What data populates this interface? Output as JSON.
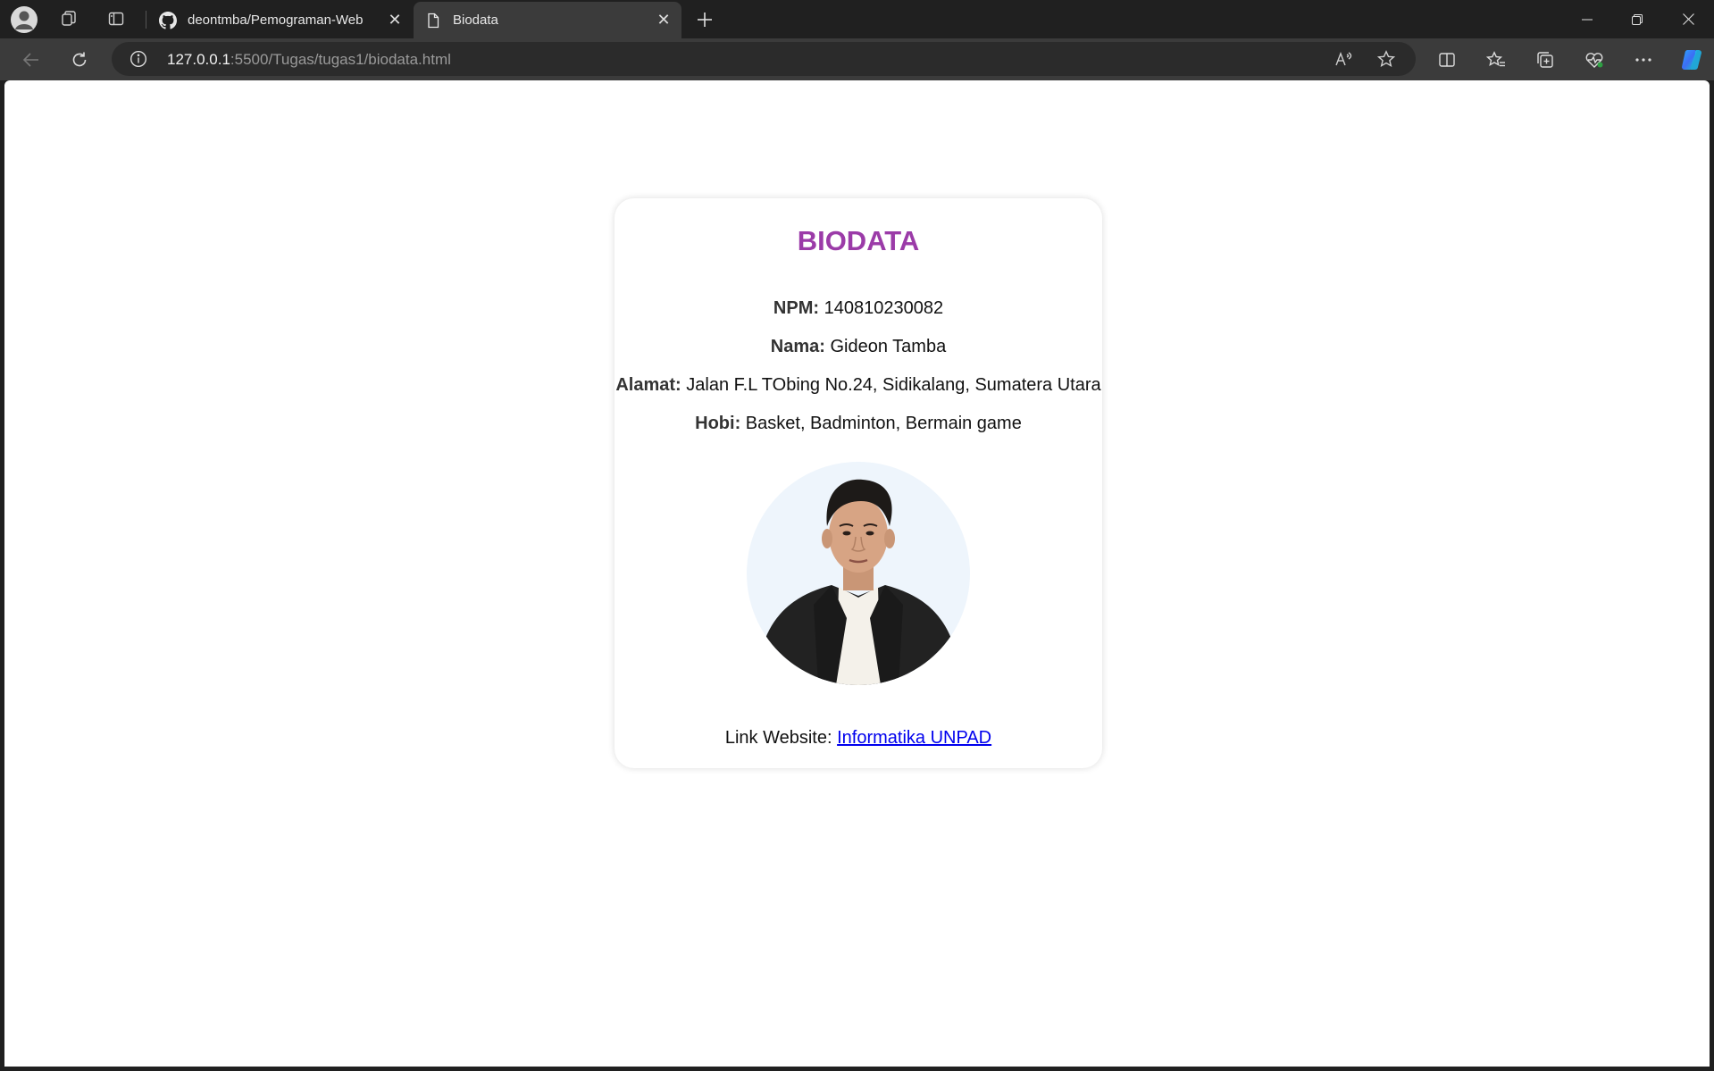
{
  "browser": {
    "tabs": [
      {
        "title": "deontmba/Pemograman-Web",
        "favicon": "github-icon",
        "active": false
      },
      {
        "title": "Biodata",
        "favicon": "page-icon",
        "active": true
      }
    ],
    "address": {
      "host": "127.0.0.1",
      "rest": ":5500/Tugas/tugas1/biodata.html"
    },
    "accent": "#9b3ba8"
  },
  "page": {
    "heading": "BIODATA",
    "fields": [
      {
        "label": "NPM:",
        "value": "140810230082"
      },
      {
        "label": "Nama:",
        "value": "Gideon Tamba"
      },
      {
        "label": "Alamat:",
        "value": "Jalan F.L TObing No.24, Sidikalang, Sumatera Utara"
      },
      {
        "label": "Hobi:",
        "value": "Basket, Badminton, Bermain game"
      }
    ],
    "photo_alt": "profile-photo",
    "link_prefix": "Link Website:",
    "link_text": "Informatika UNPAD"
  }
}
